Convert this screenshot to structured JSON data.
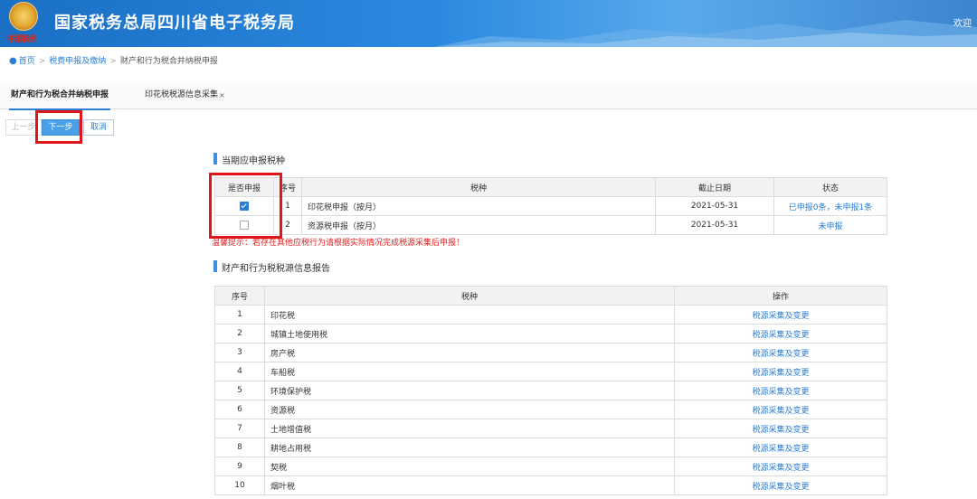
{
  "header": {
    "title": "国家税务总局四川省电子税务局",
    "emblem_sub": "中国税务",
    "welcome": "欢迎"
  },
  "breadcrumb": [
    "首页",
    "税费申报及缴纳",
    "财产和行为税合并纳税申报"
  ],
  "tabs": [
    {
      "label": "财产和行为税合并纳税申报"
    },
    {
      "label": "印花税税源信息采集",
      "close": "×"
    }
  ],
  "toolbar": {
    "prev": "上一步",
    "next": "下一步",
    "cancel": "取消"
  },
  "section1": {
    "title": "当期应申报税种",
    "headers": [
      "是否申报",
      "序号",
      "税种",
      "截止日期",
      "状态"
    ],
    "rows": [
      {
        "checked": true,
        "no": "1",
        "tax": "印花税申报（按月）",
        "deadline": "2021-05-31",
        "status": "已申报0条，未申报1条"
      },
      {
        "checked": false,
        "no": "2",
        "tax": "资源税申报（按月）",
        "deadline": "2021-05-31",
        "status": "未申报"
      }
    ]
  },
  "warning": "温馨提示：若存在其他应税行为请根据实际情况完成税源采集后申报！",
  "section2": {
    "title": "财产和行为税税源信息报告",
    "headers": [
      "序号",
      "税种",
      "操作"
    ],
    "rows": [
      {
        "no": "1",
        "tax": "印花税",
        "op": "税源采集及变更"
      },
      {
        "no": "2",
        "tax": "城镇土地使用税",
        "op": "税源采集及变更"
      },
      {
        "no": "3",
        "tax": "房产税",
        "op": "税源采集及变更"
      },
      {
        "no": "4",
        "tax": "车船税",
        "op": "税源采集及变更"
      },
      {
        "no": "5",
        "tax": "环境保护税",
        "op": "税源采集及变更"
      },
      {
        "no": "6",
        "tax": "资源税",
        "op": "税源采集及变更"
      },
      {
        "no": "7",
        "tax": "土地增值税",
        "op": "税源采集及变更"
      },
      {
        "no": "8",
        "tax": "耕地占用税",
        "op": "税源采集及变更"
      },
      {
        "no": "9",
        "tax": "契税",
        "op": "税源采集及变更"
      },
      {
        "no": "10",
        "tax": "烟叶税",
        "op": "税源采集及变更"
      }
    ]
  },
  "colors": {
    "accent": "#2a7fd4",
    "highlight": "#e0161b",
    "header": "#2b8ae0"
  }
}
